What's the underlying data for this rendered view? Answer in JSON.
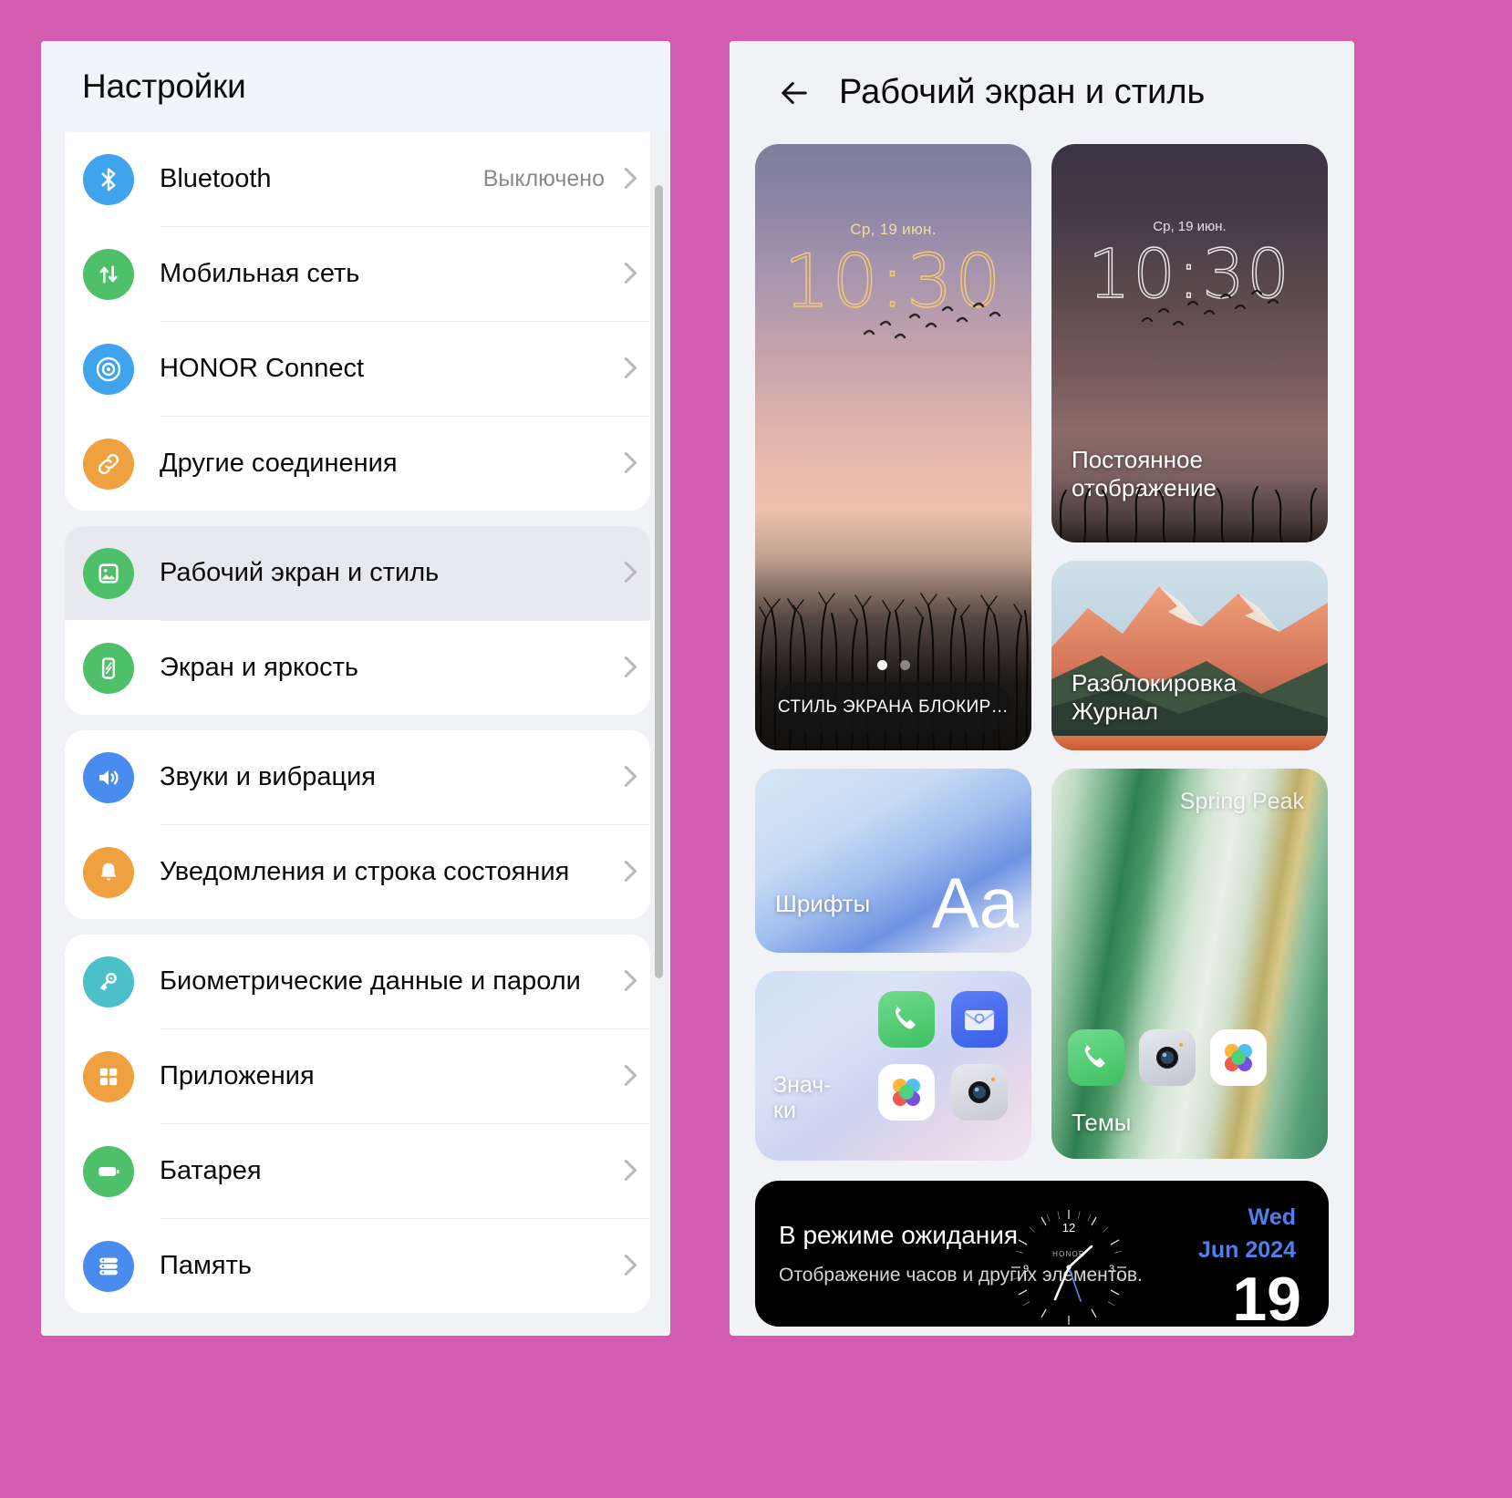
{
  "theme": {
    "page_background": "#d45cb0",
    "panel_background": "#f1f2f6",
    "card_white": "#ffffff",
    "selected_row": "#e7e9ee",
    "accent_blue": "#4f7fec"
  },
  "settings_panel": {
    "title": "Настройки",
    "groups": [
      {
        "items": [
          {
            "label": "Bluetooth",
            "value": "Выключено",
            "icon": "bluetooth-icon",
            "icon_color": "#3fa3ee"
          },
          {
            "label": "Мобильная сеть",
            "value": "",
            "icon": "mobile-network-icon",
            "icon_color": "#4fc06a"
          },
          {
            "label": "HONOR Connect",
            "value": "",
            "icon": "honor-connect-icon",
            "icon_color": "#3fa3ee"
          },
          {
            "label": "Другие соединения",
            "value": "",
            "icon": "link-icon",
            "icon_color": "#efa03f"
          }
        ]
      },
      {
        "items": [
          {
            "label": "Рабочий экран и стиль",
            "value": "",
            "icon": "image-icon",
            "icon_color": "#4fc06a",
            "selected": true
          },
          {
            "label": "Экран и яркость",
            "value": "",
            "icon": "brightness-icon",
            "icon_color": "#4fc06a"
          }
        ]
      },
      {
        "items": [
          {
            "label": "Звуки и вибрация",
            "value": "",
            "icon": "speaker-icon",
            "icon_color": "#4a8bf0"
          },
          {
            "label": "Уведомления и строка состояния",
            "value": "",
            "icon": "bell-icon",
            "icon_color": "#efa03f"
          }
        ]
      },
      {
        "items": [
          {
            "label": "Биометрические данные и пароли",
            "value": "",
            "icon": "key-icon",
            "icon_color": "#4cc0c8"
          },
          {
            "label": "Приложения",
            "value": "",
            "icon": "apps-grid-icon",
            "icon_color": "#efa03f"
          },
          {
            "label": "Батарея",
            "value": "",
            "icon": "battery-icon",
            "icon_color": "#4fc06a"
          },
          {
            "label": "Память",
            "value": "",
            "icon": "storage-icon",
            "icon_color": "#4a8bf0"
          }
        ]
      }
    ]
  },
  "detail_panel": {
    "back_icon": "arrow-left-icon",
    "title": "Рабочий экран и стиль",
    "lock_screen_card": {
      "date": "Ср, 19 июн.",
      "time": "10:30",
      "pill_label": "СТИЛЬ ЭКРАНА БЛОКИР…",
      "page_dots": 2,
      "active_dot": 1
    },
    "always_on_card": {
      "date": "Ср, 19 июн.",
      "time": "10:30",
      "label_line1": "Постоянное",
      "label_line2": "отображение"
    },
    "journal_card": {
      "label_line1": "Разблокировка",
      "label_line2": "Журнал"
    },
    "fonts_card": {
      "label": "Шрифты",
      "sample": "Aa"
    },
    "icons_card": {
      "label_line1": "Знач-",
      "label_line2": "ки",
      "app_icons": [
        "phone-icon",
        "email-icon",
        "gallery-icon",
        "camera-icon"
      ]
    },
    "themes_card": {
      "wallpaper_title": "Spring Peak",
      "label": "Темы",
      "app_icons": [
        "phone-icon",
        "camera-icon",
        "gallery-icon"
      ]
    },
    "standby_card": {
      "title": "В режиме ожидания",
      "subtitle": "Отображение часов и других элементов.",
      "watch_brand": "HONOR",
      "watch_twelve": "12",
      "watch_nine": "9",
      "watch_three": "3",
      "weekday": "Wed",
      "month_year": "Jun 2024",
      "day_number": "19"
    }
  }
}
